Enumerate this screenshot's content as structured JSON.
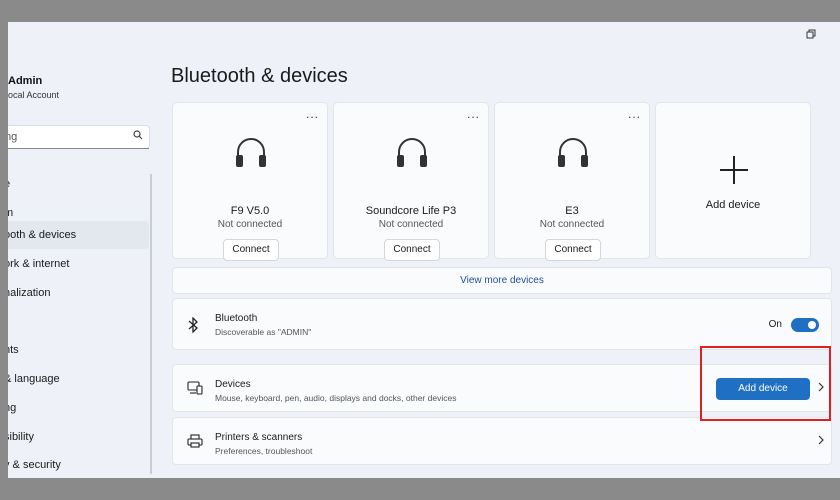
{
  "window": {
    "minimize_icon": "restore-icon"
  },
  "user": {
    "name": "Admin",
    "account": "ocal Account"
  },
  "search": {
    "placeholder": "ng"
  },
  "nav": {
    "items": [
      {
        "label": "e"
      },
      {
        "label": "m"
      },
      {
        "label": "ooth & devices",
        "active": true
      },
      {
        "label": "ork & internet"
      },
      {
        "label": "nalization"
      },
      {
        "label": ""
      },
      {
        "label": "nts"
      },
      {
        "label": "& language"
      },
      {
        "label": "ng"
      },
      {
        "label": "sibility"
      },
      {
        "label": "y & security"
      }
    ]
  },
  "page": {
    "title": "Bluetooth & devices"
  },
  "devices": [
    {
      "name": "F9 V5.0",
      "status": "Not connected",
      "button": "Connect",
      "icon": "headphones-icon"
    },
    {
      "name": "Soundcore Life P3",
      "status": "Not connected",
      "button": "Connect",
      "icon": "headphones-icon"
    },
    {
      "name": "E3",
      "status": "Not connected",
      "button": "Connect",
      "icon": "headphones-icon"
    }
  ],
  "add_card": {
    "label": "Add device",
    "menu": "..."
  },
  "menu_glyph": "...",
  "view_more": "View more devices",
  "bluetooth": {
    "title": "Bluetooth",
    "subtitle": "Discoverable as \"ADMIN\"",
    "toggle_label": "On",
    "toggle_on": true
  },
  "devices_row": {
    "title": "Devices",
    "subtitle": "Mouse, keyboard, pen, audio, displays and docks, other devices",
    "button": "Add device"
  },
  "printers_row": {
    "title": "Printers & scanners",
    "subtitle": "Preferences, troubleshoot"
  },
  "colors": {
    "accent": "#1f6fc3",
    "highlight": "#e02020"
  }
}
